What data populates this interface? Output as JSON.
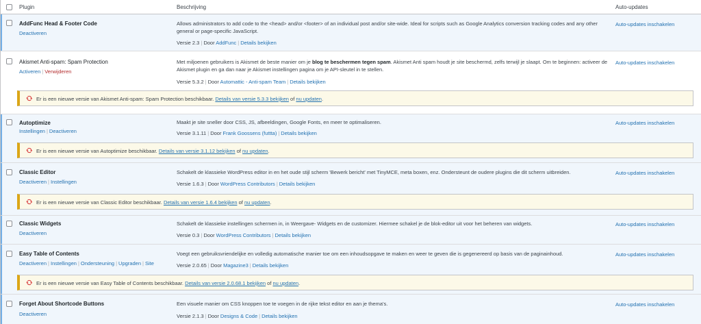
{
  "header": {
    "col_plugin": "Plugin",
    "col_description": "Beschrijving",
    "col_autoupdates": "Auto-updates"
  },
  "colors": {
    "link": "#2271b1",
    "delete": "#b32d2e",
    "active_row": "#f0f6fc",
    "notice_bg": "#fcf9e8",
    "notice_border": "#dba617",
    "update_icon": "#d63638"
  },
  "plugins": [
    {
      "name": "AddFunc Head & Footer Code",
      "actions": [
        "Deactiveren"
      ],
      "description": "Allows administrators to add code to the <head> and/or <footer> of an individual post and/or site-wide. Ideal for scripts such as Google Analytics conversion tracking codes and any other general or page-specific JavaScript.",
      "version": "Versie 2.3",
      "by": "Door",
      "author": "AddFunc",
      "details": "Details bekijken",
      "autoupdate": "Auto-updates inschakelen"
    },
    {
      "name": "Akismet Anti-spam: Spam Protection",
      "actions": [
        "Activeren",
        "Verwijderen"
      ],
      "desc_part1": "Met miljoenen gebruikers is Akismet de beste manier om je ",
      "desc_bold": "blog te beschermen tegen spam",
      "desc_part2": ". Akismet Anti spam houdt je site beschermd, zelfs terwijl je slaapt. Om te beginnen: activeer de Akismet plugin en ga dan naar je Akismet instellingen pagina om je API-sleutel in te stellen.",
      "version": "Versie 5.3.2",
      "by": "Door",
      "author": "Automattic - Anti-spam Team",
      "details": "Details bekijken",
      "autoupdate": "Auto-updates inschakelen",
      "notice": {
        "text": "Er is een nieuwe versie van Akismet Anti-spam: Spam Protection beschikbaar.",
        "details_link": "Details van versie 5.3.3 bekijken",
        "or": "of",
        "update_link": "nu updaten",
        "end": "."
      }
    },
    {
      "name": "Autoptimize",
      "actions": [
        "Instellingen",
        "Deactiveren"
      ],
      "description": "Maakt je site sneller door CSS, JS, afbeeldingen, Google Fonts, en meer te optimaliseren.",
      "version": "Versie 3.1.11",
      "by": "Door",
      "author": "Frank Goossens (futtta)",
      "details": "Details bekijken",
      "autoupdate": "Auto-updates inschakelen",
      "notice": {
        "text": "Er is een nieuwe versie van Autoptimize beschikbaar.",
        "details_link": "Details van versie 3.1.12 bekijken",
        "or": "of",
        "update_link": "nu updaten",
        "end": "."
      }
    },
    {
      "name": "Classic Editor",
      "actions": [
        "Deactiveren",
        "Instellingen"
      ],
      "description": "Schakelt de klassieke WordPress editor in en het oude stijl scherm 'Bewerk bericht' met TinyMCE, meta boxen, enz. Ondersteunt de oudere plugins die dit scherm uitbreiden.",
      "version": "Versie 1.6.3",
      "by": "Door",
      "author": "WordPress Contributors",
      "details": "Details bekijken",
      "autoupdate": "Auto-updates inschakelen",
      "notice": {
        "text": "Er is een nieuwe versie van Classic Editor beschikbaar.",
        "details_link": "Details van versie 1.6.4 bekijken",
        "or": "of",
        "update_link": "nu updaten",
        "end": "."
      }
    },
    {
      "name": "Classic Widgets",
      "actions": [
        "Deactiveren"
      ],
      "description": "Schakelt de klassieke instellingen schermen in, in Weergave- Widgets en de customizer. Hiermee schakel je de blok-editor uit voor het beheren van widgets.",
      "version": "Versie 0.3",
      "by": "Door",
      "author": "WordPress Contributors",
      "details": "Details bekijken",
      "autoupdate": "Auto-updates inschakelen"
    },
    {
      "name": "Easy Table of Contents",
      "actions": [
        "Deactiveren",
        "Instellingen",
        "Ondersteuning",
        "Upgraden",
        "Site"
      ],
      "description": "Voegt een gebruiksvriendelijke en volledig automatische manier toe om een inhoudsopgave te maken en weer te geven die is gegenereerd op basis van de paginainhoud.",
      "version": "Versie 2.0.65",
      "by": "Door",
      "author": "Magazine3",
      "details": "Details bekijken",
      "autoupdate": "Auto-updates inschakelen",
      "notice": {
        "text": "Er is een nieuwe versie van Easy Table of Contents beschikbaar.",
        "details_link": "Details van versie 2.0.68.1 bekijken",
        "or": "of",
        "update_link": "nu updaten",
        "end": "."
      }
    },
    {
      "name": "Forget About Shortcode Buttons",
      "actions": [
        "Deactiveren"
      ],
      "description": "Een visuele manier om CSS knoppen toe te voegen in de rijke tekst editor en aan je thema's.",
      "version": "Versie 2.1.3",
      "by": "Door",
      "author": "Designs & Code",
      "details": "Details bekijken",
      "autoupdate": "Auto-updates inschakelen"
    }
  ]
}
